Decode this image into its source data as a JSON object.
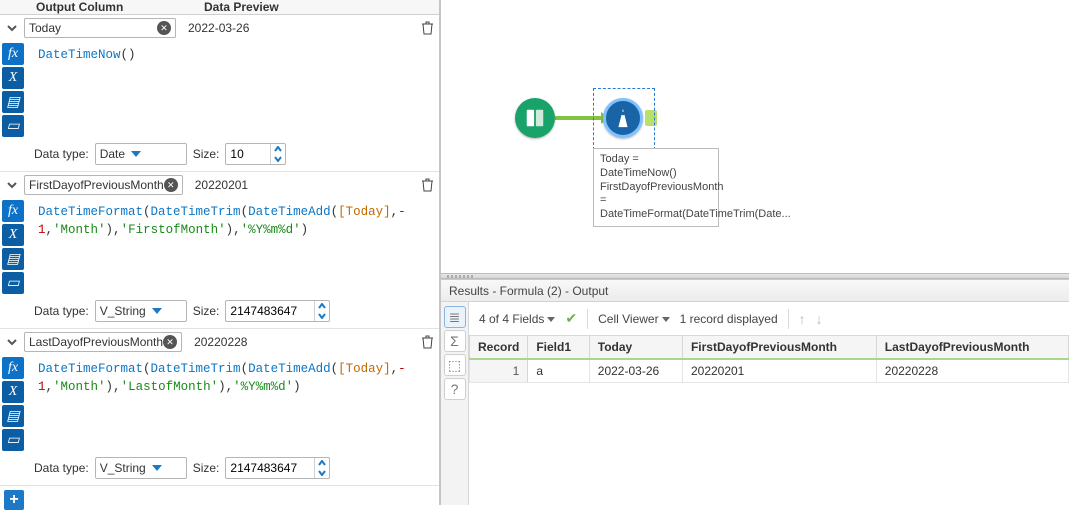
{
  "headers": {
    "output_column": "Output Column",
    "data_preview": "Data Preview"
  },
  "labels": {
    "data_type": "Data type:",
    "size": "Size:"
  },
  "gutter": {
    "fx": "fx",
    "x": "X",
    "folder": "▤",
    "save": "▭"
  },
  "formulas": [
    {
      "name": "Today",
      "preview": "2022-03-26",
      "expr_tokens": [
        {
          "t": "fn",
          "v": "DateTimeNow"
        },
        {
          "t": "p",
          "v": "()"
        }
      ],
      "data_type": "Date",
      "data_type_width": 92,
      "size_value": "10",
      "size_width": 44
    },
    {
      "name": "FirstDayofPreviousMonth",
      "preview": "20220201",
      "expr_tokens": [
        {
          "t": "fn",
          "v": "DateTimeFormat"
        },
        {
          "t": "p",
          "v": "("
        },
        {
          "t": "fn",
          "v": "DateTimeTrim"
        },
        {
          "t": "p",
          "v": "("
        },
        {
          "t": "fn",
          "v": "DateTimeAdd"
        },
        {
          "t": "p",
          "v": "("
        },
        {
          "t": "fld",
          "v": "[Today]"
        },
        {
          "t": "p",
          "v": ","
        },
        {
          "t": "num",
          "v": "-1"
        },
        {
          "t": "p",
          "v": ","
        },
        {
          "t": "str",
          "v": "'Month'"
        },
        {
          "t": "p",
          "v": "),"
        },
        {
          "t": "str",
          "v": "'FirstofMonth'"
        },
        {
          "t": "p",
          "v": "),"
        },
        {
          "t": "str",
          "v": "'%Y%m%d'"
        },
        {
          "t": "p",
          "v": ")"
        }
      ],
      "data_type": "V_String",
      "data_type_width": 92,
      "size_value": "2147483647",
      "size_width": 88
    },
    {
      "name": "LastDayofPreviousMonth",
      "preview": "20220228",
      "expr_tokens": [
        {
          "t": "fn",
          "v": "DateTimeFormat"
        },
        {
          "t": "p",
          "v": "("
        },
        {
          "t": "fn",
          "v": "DateTimeTrim"
        },
        {
          "t": "p",
          "v": "("
        },
        {
          "t": "fn",
          "v": "DateTimeAdd"
        },
        {
          "t": "p",
          "v": "("
        },
        {
          "t": "fld",
          "v": "[Today]"
        },
        {
          "t": "p",
          "v": ","
        },
        {
          "t": "num",
          "v": "-1"
        },
        {
          "t": "p",
          "v": ","
        },
        {
          "t": "str",
          "v": "'Month'"
        },
        {
          "t": "p",
          "v": "),"
        },
        {
          "t": "str",
          "v": "'LastofMonth'"
        },
        {
          "t": "p",
          "v": "),"
        },
        {
          "t": "str",
          "v": "'%Y%m%d'"
        },
        {
          "t": "p",
          "v": ")"
        }
      ],
      "data_type": "V_String",
      "data_type_width": 92,
      "size_value": "2147483647",
      "size_width": 88
    }
  ],
  "canvas_annotation": "Today = DateTimeNow()\nFirstDayofPreviousMonth = DateTimeFormat(DateTimeTrim(Date...",
  "results": {
    "title": "Results - Formula (2) - Output",
    "fields_summary": "4 of 4 Fields",
    "cell_viewer": "Cell Viewer",
    "record_summary": "1 record displayed",
    "columns": [
      "Record",
      "Field1",
      "Today",
      "FirstDayofPreviousMonth",
      "LastDayofPreviousMonth"
    ],
    "rows": [
      {
        "Record": "1",
        "Field1": "a",
        "Today": "2022-03-26",
        "FirstDayofPreviousMonth": "20220201",
        "LastDayofPreviousMonth": "20220228"
      }
    ]
  }
}
